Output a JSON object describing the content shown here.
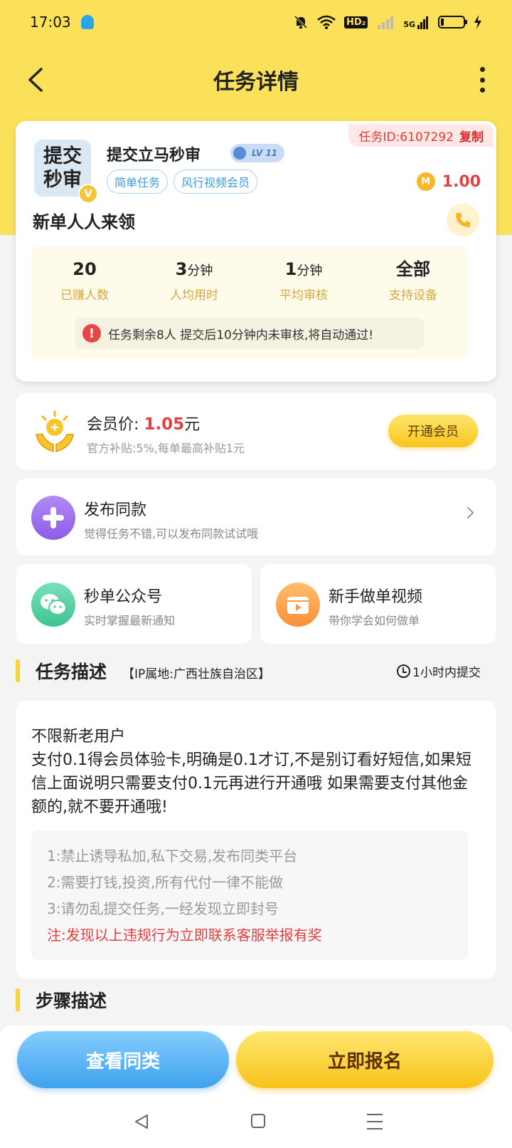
{
  "status_bar": {
    "time": "17:03",
    "icons": [
      "qq-icon",
      "mute-bell-icon",
      "wifi-icon",
      "hd-icon",
      "signal-icon",
      "5g-signal-icon",
      "battery-icon",
      "charging-icon"
    ],
    "hd_label": "HD₂",
    "net_label": "5G"
  },
  "nav": {
    "title": "任务详情"
  },
  "task": {
    "id_label": "任务ID:6107292",
    "copy_label": "复制",
    "logo_line1": "提交",
    "logo_line2": "秒审",
    "logo_badge": "V",
    "name": "提交立马秒审",
    "level": "LV 11",
    "tags": [
      "简单任务",
      "风行视频会员"
    ],
    "coin_symbol": "M",
    "reward": "1.00",
    "subtitle": "新单人人来领",
    "stats": [
      {
        "value": "20",
        "unit": "",
        "label": "已赚人数"
      },
      {
        "value": "3",
        "unit": "分钟",
        "label": "人均用时"
      },
      {
        "value": "1",
        "unit": "分钟",
        "label": "平均审核"
      },
      {
        "value": "全部",
        "unit": "",
        "label": "支持设备"
      }
    ],
    "notice": "任务剩余8人  提交后10分钟内未审核,将自动通过!"
  },
  "member": {
    "price_label": "会员价:",
    "price_value": "1.05",
    "price_unit": "元",
    "desc": "官方补贴:5%,每单最高补贴1元",
    "button": "开通会员"
  },
  "publish": {
    "title": "发布同款",
    "desc": "觉得任务不错,可以发布同款试试哦"
  },
  "official_account": {
    "title": "秒单公众号",
    "desc": "实时掌握最新通知"
  },
  "tutorial_video": {
    "title": "新手做单视频",
    "desc": "带你学会如何做单"
  },
  "description_section": {
    "title": "任务描述",
    "ip_location": "【IP属地:广西壮族自治区】",
    "deadline": "1小时内提交",
    "text_line1": "不限新老用户",
    "text_line2": "支付0.1得会员体验卡,明确是0.1才订,不是别订看好短信,如果短信上面说明只需要支付0.1元再进行开通哦 如果需要支付其他金额的,就不要开通哦!",
    "rules": [
      "1:禁止诱导私加,私下交易,发布同类平台",
      "2:需要打钱,投资,所有代付一律不能做",
      "3:请勿乱提交任务,一经发现立即封号"
    ],
    "warning": "注:发现以上违规行为立即联系客服举报有奖"
  },
  "steps_section": {
    "title": "步骤描述"
  },
  "actions": {
    "view_similar": "查看同类",
    "sign_up": "立即报名"
  },
  "colors": {
    "brand_yellow": "#fbe15a",
    "accent_red": "#e24242",
    "accent_blue": "#3ea2ec"
  }
}
